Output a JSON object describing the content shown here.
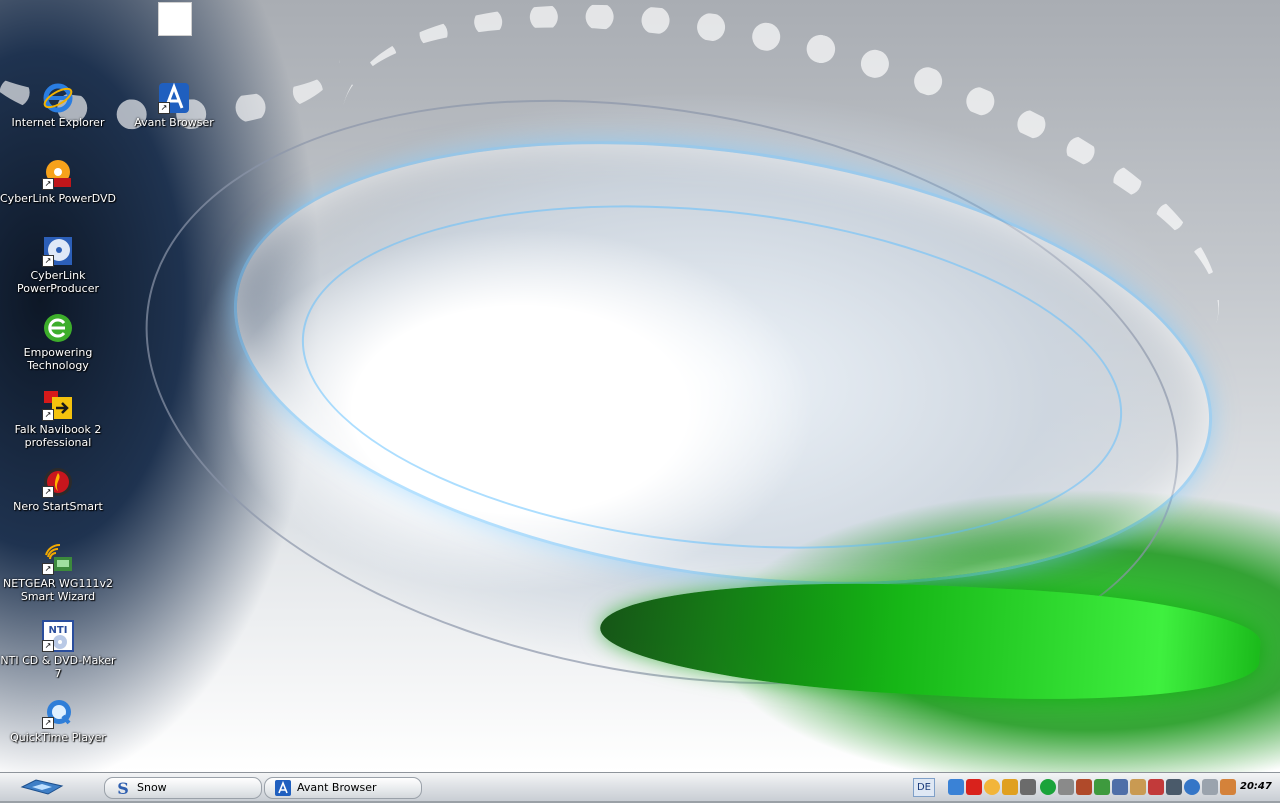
{
  "desktop": {
    "icons": [
      {
        "label": "Internet Explorer",
        "icon": "internet-explorer-icon"
      },
      {
        "label": "Avant Browser",
        "icon": "avant-browser-icon"
      },
      {
        "label": "CyberLink PowerDVD",
        "icon": "powerdvd-icon"
      },
      {
        "label": "CyberLink\nPowerProducer",
        "icon": "powerproducer-icon"
      },
      {
        "label": "Empowering\nTechnology",
        "icon": "empowering-technology-icon"
      },
      {
        "label": "Falk Navibook 2\nprofessional",
        "icon": "falk-navibook-icon"
      },
      {
        "label": "Nero StartSmart",
        "icon": "nero-icon"
      },
      {
        "label": "NETGEAR WG111v2\nSmart Wizard",
        "icon": "netgear-icon"
      },
      {
        "label": "NTI CD & DVD-Maker 7",
        "icon": "nti-cd-dvd-maker-icon"
      },
      {
        "label": "QuickTime Player",
        "icon": "quicktime-icon"
      }
    ]
  },
  "taskbar": {
    "start_icon": "start-logo-icon",
    "buttons": [
      {
        "label": "Snow",
        "icon": "snow-app-icon"
      },
      {
        "label": "Avant Browser",
        "icon": "avant-browser-icon"
      }
    ],
    "language": "DE",
    "tray_icons": [
      "network-icon",
      "ati-icon",
      "sun-icon",
      "shield-icon",
      "speaker-icon",
      "green-circle-icon",
      "printer-icon",
      "tool-icon",
      "plant-icon",
      "signal-icon",
      "person-icon",
      "cards-icon",
      "monitor-icon",
      "globe-icon",
      "drive-icon",
      "gear-icon"
    ],
    "clock": "20:47"
  }
}
